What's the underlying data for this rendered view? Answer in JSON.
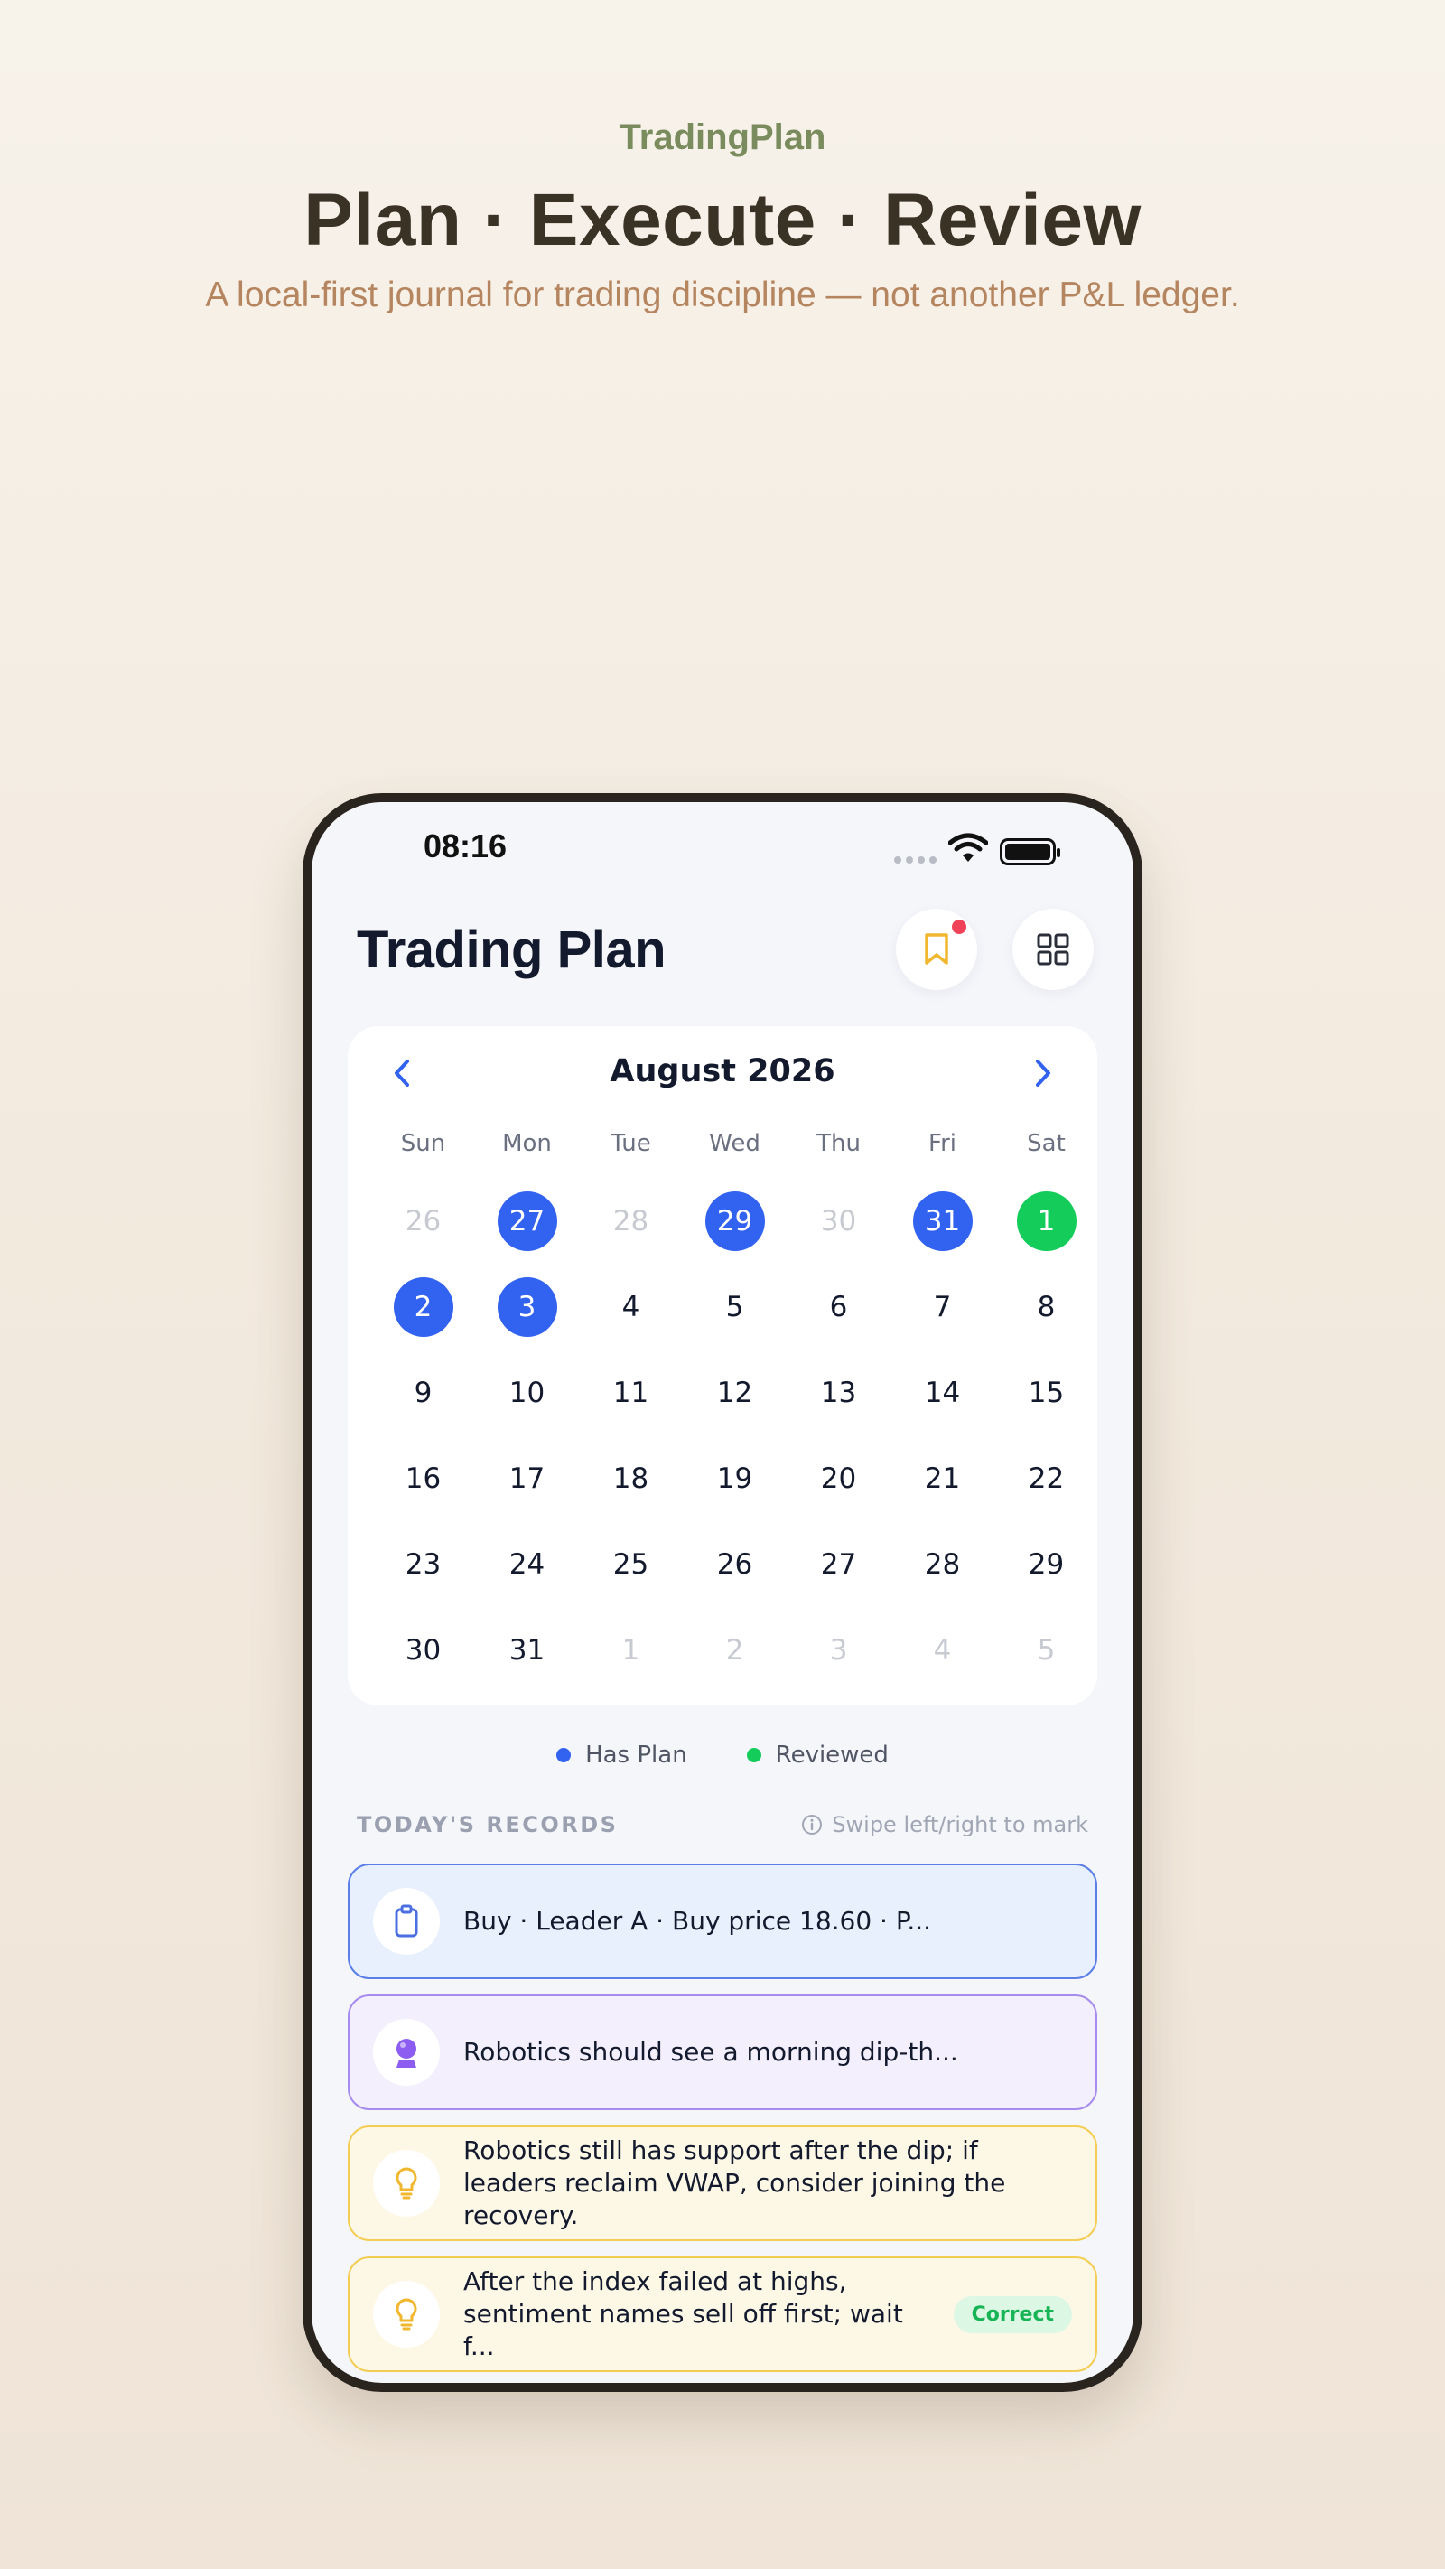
{
  "hero": {
    "brand": "TradingPlan",
    "headline": "Plan · Execute · Review",
    "tagline": "A local-first journal for trading discipline — not another P&L ledger."
  },
  "status": {
    "time": "08:16",
    "icons": [
      "signal-icon",
      "wifi-icon",
      "battery-icon"
    ]
  },
  "app": {
    "title": "Trading Plan",
    "actions": [
      {
        "icon": "bookmark-icon",
        "has_notification": true
      },
      {
        "icon": "grid-icon"
      }
    ]
  },
  "calendar": {
    "month_label": "August 2026",
    "weekdays": [
      "Sun",
      "Mon",
      "Tue",
      "Wed",
      "Thu",
      "Fri",
      "Sat"
    ],
    "days": [
      {
        "label": "26",
        "state": "muted"
      },
      {
        "label": "27",
        "state": "plan"
      },
      {
        "label": "28",
        "state": "muted"
      },
      {
        "label": "29",
        "state": "plan"
      },
      {
        "label": "30",
        "state": "muted"
      },
      {
        "label": "31",
        "state": "plan"
      },
      {
        "label": "1",
        "state": "reviewed"
      },
      {
        "label": "2",
        "state": "plan"
      },
      {
        "label": "3",
        "state": "plan"
      },
      {
        "label": "4",
        "state": "normal"
      },
      {
        "label": "5",
        "state": "normal"
      },
      {
        "label": "6",
        "state": "normal"
      },
      {
        "label": "7",
        "state": "normal"
      },
      {
        "label": "8",
        "state": "normal"
      },
      {
        "label": "9",
        "state": "normal"
      },
      {
        "label": "10",
        "state": "normal"
      },
      {
        "label": "11",
        "state": "normal"
      },
      {
        "label": "12",
        "state": "normal"
      },
      {
        "label": "13",
        "state": "normal"
      },
      {
        "label": "14",
        "state": "normal"
      },
      {
        "label": "15",
        "state": "normal"
      },
      {
        "label": "16",
        "state": "normal"
      },
      {
        "label": "17",
        "state": "normal"
      },
      {
        "label": "18",
        "state": "normal"
      },
      {
        "label": "19",
        "state": "normal"
      },
      {
        "label": "20",
        "state": "normal"
      },
      {
        "label": "21",
        "state": "normal"
      },
      {
        "label": "22",
        "state": "normal"
      },
      {
        "label": "23",
        "state": "normal"
      },
      {
        "label": "24",
        "state": "normal"
      },
      {
        "label": "25",
        "state": "normal"
      },
      {
        "label": "26",
        "state": "normal"
      },
      {
        "label": "27",
        "state": "normal"
      },
      {
        "label": "28",
        "state": "normal"
      },
      {
        "label": "29",
        "state": "normal"
      },
      {
        "label": "30",
        "state": "normal"
      },
      {
        "label": "31",
        "state": "normal"
      },
      {
        "label": "1",
        "state": "muted"
      },
      {
        "label": "2",
        "state": "muted"
      },
      {
        "label": "3",
        "state": "muted"
      },
      {
        "label": "4",
        "state": "muted"
      },
      {
        "label": "5",
        "state": "muted"
      }
    ]
  },
  "legend": [
    {
      "label": "Has Plan",
      "color": "#3262f0"
    },
    {
      "label": "Reviewed",
      "color": "#14cc5a"
    }
  ],
  "records": {
    "heading": "TODAY'S RECORDS",
    "hint": "Swipe left/right to mark",
    "items": [
      {
        "icon": "clipboard-icon",
        "text": "Buy · Leader A · Buy price 18.60 · P..."
      },
      {
        "icon": "crystal-ball-icon",
        "text": "Robotics should see a morning dip-th..."
      },
      {
        "icon": "lightbulb-icon",
        "text": "Robotics still has support after the dip; if leaders reclaim VWAP, consider joining the recovery."
      },
      {
        "icon": "lightbulb-icon",
        "text": "After the index failed at highs, sentiment names sell off first; wait f...",
        "badge": "Correct"
      }
    ]
  }
}
